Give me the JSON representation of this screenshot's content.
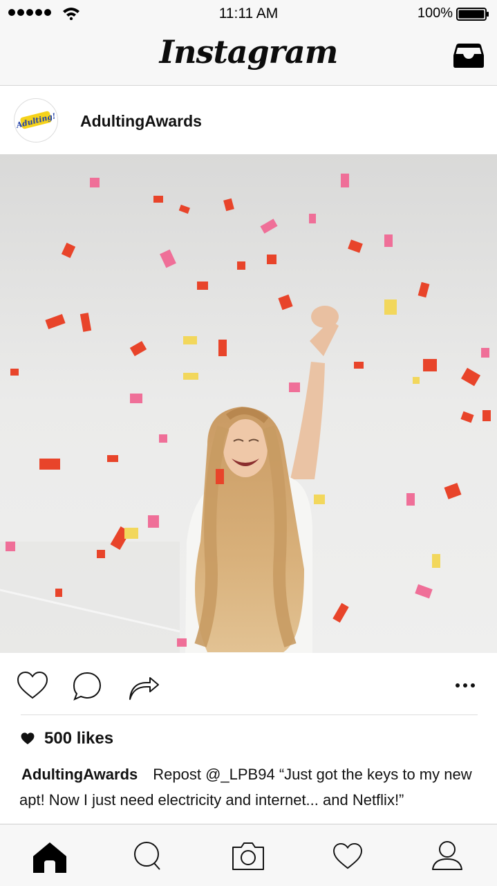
{
  "status_bar": {
    "time": "11:11 AM",
    "battery": "100%"
  },
  "header": {
    "logo_text": "Instagram",
    "inbox_icon": "inbox-tray-icon"
  },
  "post": {
    "username": "AdultingAwards",
    "avatar_text": "Adulting!",
    "likes": "500 likes",
    "caption_user": "AdultingAwards",
    "caption_text": "Repost @_LPB94 “Just got the keys to my new apt! Now I just need electricity and internet... and Netflix!”",
    "photo_description_icon": "photo"
  },
  "actions": {
    "like_icon": "heart-outline-icon",
    "comment_icon": "comment-bubble-icon",
    "share_icon": "share-arrow-icon",
    "more_icon": "more-dots-icon"
  },
  "tabs": [
    {
      "icon": "home-icon"
    },
    {
      "icon": "search-icon"
    },
    {
      "icon": "camera-icon"
    },
    {
      "icon": "heart-icon"
    },
    {
      "icon": "profile-icon"
    }
  ],
  "colors": {
    "bar_background": "#f7f7f7",
    "avatar_yellow": "#f5d21a",
    "confetti_red": "#e8442a",
    "confetti_pink": "#ef6f98"
  }
}
